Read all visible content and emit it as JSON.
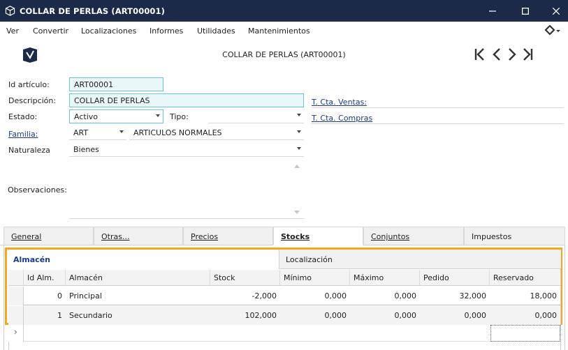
{
  "window": {
    "title": "COLLAR DE PERLAS (ART00001)",
    "minimize_glyph": "—",
    "maximize_glyph": "☐",
    "close_glyph": "✕"
  },
  "menu": {
    "items": [
      "Ver",
      "Convertir",
      "Localizaciones",
      "Informes",
      "Utilidades",
      "Mantenimientos"
    ]
  },
  "header": {
    "title": "COLLAR DE PERLAS (ART00001)"
  },
  "form": {
    "id_label": "Id artículo:",
    "id_value": "ART00001",
    "desc_label": "Descripción:",
    "desc_value": "COLLAR DE PERLAS",
    "estado_label": "Estado:",
    "estado_value": "Activo",
    "tipo_label": "Tipo:",
    "tipo_value": "",
    "familia_label": "Familia:",
    "familia_code": "ART",
    "familia_name": "ARTICULOS NORMALES",
    "naturaleza_label": "Naturaleza",
    "naturaleza_value": "Bienes",
    "observaciones_label": "Observaciones:",
    "cta_ventas_label": "T. Cta. Ventas:",
    "cta_compras_label": "T. Cta. Compras"
  },
  "tabs": [
    "General",
    "Otras...",
    "Precios",
    "Stocks",
    "Conjuntos",
    "Impuestos"
  ],
  "active_tab": "Stocks",
  "subtabs": [
    "Almacén",
    "Localización"
  ],
  "grid": {
    "columns": [
      "Id Alm.",
      "Almacén",
      "Stock",
      "Mínimo",
      "Máximo",
      "Pedido",
      "Reservado"
    ],
    "rows": [
      {
        "id": "0",
        "almacen": "Principal",
        "stock": "-2,000",
        "minimo": "0,000",
        "maximo": "0,000",
        "pedido": "32,000",
        "reservado": "18,000"
      },
      {
        "id": "1",
        "almacen": "Secundario",
        "stock": "102,000",
        "minimo": "0,000",
        "maximo": "0,000",
        "pedido": "0,000",
        "reservado": "0,000"
      }
    ],
    "new_row_marker": "›"
  },
  "colors": {
    "titlebar": "#1c2a4a",
    "accent_border": "#f6a81c",
    "field_border": "#69c4d3",
    "link": "#1b3a8a"
  },
  "icons": {
    "app": "package-icon",
    "logo": "brand-logo",
    "nav": [
      "first-record-icon",
      "previous-record-icon",
      "next-record-icon",
      "last-record-icon"
    ],
    "menu_right": "settings-dropdown-icon"
  }
}
